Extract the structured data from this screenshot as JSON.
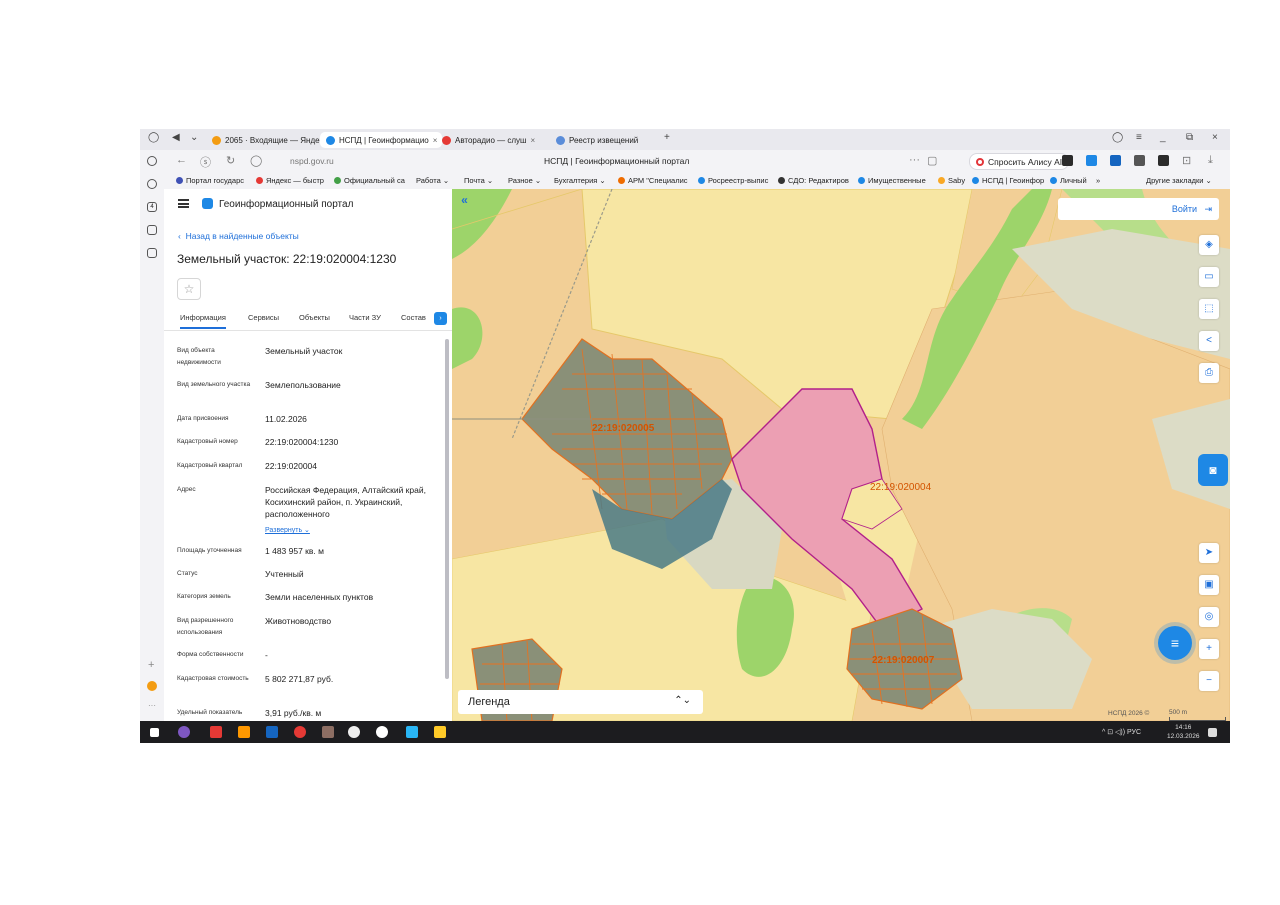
{
  "browser": {
    "tabs": [
      {
        "title": "2065 · Входящие — Яндекс",
        "active": false,
        "icon_color": "#f39c12"
      },
      {
        "title": "НСПД | Геоинформацио",
        "active": true,
        "icon_color": "#1e88e5"
      },
      {
        "title": "Авторадио — слуш",
        "active": false,
        "icon_color": "#e53935"
      },
      {
        "title": "Реестр извещений",
        "active": false,
        "icon_color": "#5b8dd9"
      }
    ],
    "new_tab": "+",
    "url": "nspd.gov.ru",
    "page_title": "НСПД | Геоинформационный портал",
    "alice_button": "Спросить Алису AI",
    "bookmarks": [
      {
        "label": "Портал государс",
        "color": "#3f51b5"
      },
      {
        "label": "Яндекс — быстр",
        "color": "#e53935"
      },
      {
        "label": "Официальный са",
        "color": "#43a047"
      },
      {
        "label": "Работа ⌄",
        "color": ""
      },
      {
        "label": "Почта ⌄",
        "color": ""
      },
      {
        "label": "Разное ⌄",
        "color": ""
      },
      {
        "label": "Бухгалтерия ⌄",
        "color": ""
      },
      {
        "label": "АРМ \"Специалис",
        "color": "#ef6c00"
      },
      {
        "label": "Росреестр-выпис",
        "color": "#1e88e5"
      },
      {
        "label": "СДО: Редактиров",
        "color": "#333333"
      },
      {
        "label": "Имущественные",
        "color": "#1e88e5"
      },
      {
        "label": "Saby",
        "color": "#f9a825"
      },
      {
        "label": "НСПД | Геоинфор",
        "color": "#1e88e5"
      },
      {
        "label": "Личный",
        "color": "#1e88e5"
      },
      {
        "label": "»",
        "color": ""
      },
      {
        "label": "Другие закладки ⌄",
        "color": ""
      }
    ]
  },
  "panel": {
    "portal_name": "Геоинформационный портал",
    "back_link": "Назад в найденные объекты",
    "object_title": "Земельный участок: 22:19:020004:1230",
    "tabs": [
      "Информация",
      "Сервисы",
      "Объекты",
      "Части ЗУ",
      "Состав"
    ],
    "properties": [
      {
        "label": "Вид объекта недвижимости",
        "value": "Земельный участок"
      },
      {
        "label": "Вид земельного участка",
        "value": "Землепользование"
      },
      {
        "label": "Дата присвоения",
        "value": "11.02.2026"
      },
      {
        "label": "Кадастровый номер",
        "value": "22:19:020004:1230"
      },
      {
        "label": "Кадастровый квартал",
        "value": "22:19:020004"
      },
      {
        "label": "Адрес",
        "value": "Российская Федерация, Алтайский край, Косихинский район, п. Украинский, расположенного"
      },
      {
        "label": "Площадь уточненная",
        "value": "1 483 957 кв. м"
      },
      {
        "label": "Статус",
        "value": "Учтенный"
      },
      {
        "label": "Категория земель",
        "value": "Земли населенных пунктов"
      },
      {
        "label": "Вид разрешенного использования",
        "value": "Животноводство"
      },
      {
        "label": "Форма собственности",
        "value": "-"
      },
      {
        "label": "Кадастровая стоимость",
        "value": "5 802 271,87 руб."
      },
      {
        "label": "Удельный показатель",
        "value": "3,91 руб./кв. м"
      }
    ],
    "expand_link": "Развернуть ⌄"
  },
  "map": {
    "login_label": "Войти",
    "legend_label": "Легенда",
    "labels": [
      "22:19:020004",
      "22:19:020005",
      "22:19:020007"
    ],
    "copyright": "НСПД 2026 ©",
    "scale": "500 m",
    "colors": {
      "farmland": "#f2cf96",
      "fields": "#f7e6a3",
      "forest": "#9dd46a",
      "parcel": "#ec9fb3",
      "parcel_border": "#b2208a",
      "labels": "#d35400",
      "accent": "#1e88e5"
    }
  },
  "taskbar": {
    "tray": "^  ⊡  ◁))  РУС",
    "time": "14:16",
    "date": "12.03.2026"
  }
}
